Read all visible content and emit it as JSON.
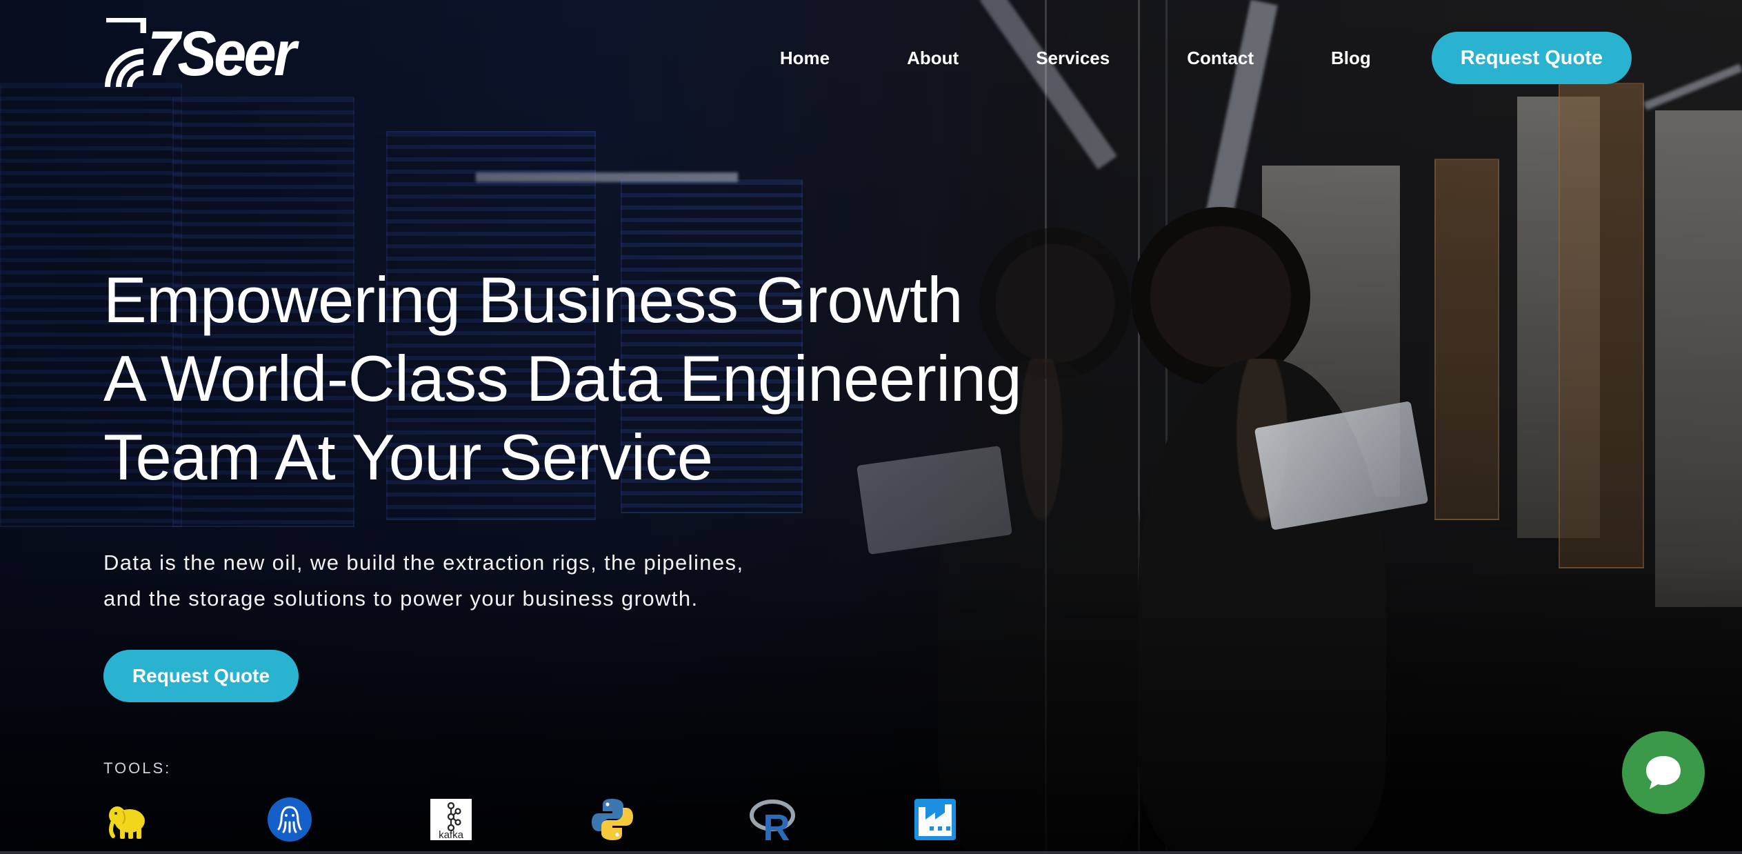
{
  "brand": {
    "name": "7Seer",
    "logo_icon": "7seer-signal-logo"
  },
  "nav": {
    "items": [
      {
        "label": "Home"
      },
      {
        "label": "About"
      },
      {
        "label": "Services"
      },
      {
        "label": "Contact"
      },
      {
        "label": "Blog"
      }
    ],
    "cta_label": "Request Quote"
  },
  "hero": {
    "headline_lines": [
      "Empowering Business Growth",
      "A World-Class Data Engineering",
      "Team At Your Service"
    ],
    "subtext_lines": [
      "Data is the new oil, we build the extraction rigs, the pipelines,",
      "and the storage solutions to power your business growth."
    ],
    "cta_label": "Request Quote"
  },
  "tools": {
    "label": "TOOLS:",
    "items": [
      {
        "icon": "hadoop-elephant-icon"
      },
      {
        "icon": "airflow-octopus-icon"
      },
      {
        "icon": "kafka-icon",
        "text": "kafka"
      },
      {
        "icon": "python-icon"
      },
      {
        "icon": "r-language-icon",
        "text": "R"
      },
      {
        "icon": "azure-data-factory-icon"
      }
    ]
  },
  "chat": {
    "icon": "chat-bubble-icon"
  },
  "colors": {
    "accent": "#29b3d1",
    "chat": "#3a9a47",
    "text": "#ffffff"
  }
}
